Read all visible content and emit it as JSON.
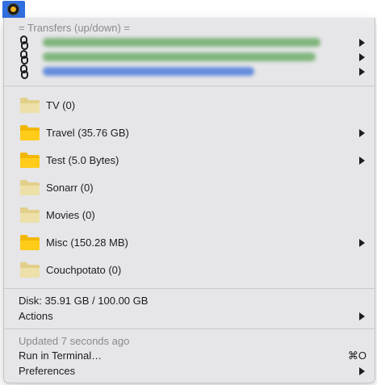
{
  "menu": {
    "transfers_header": "= Transfers (up/down) =",
    "transfers": [
      {
        "color": "#5fa55a"
      },
      {
        "color": "#5fa55a"
      },
      {
        "color": "#3b6fd8"
      }
    ],
    "folders": [
      {
        "label": "TV (0)",
        "state": "empty",
        "has_submenu": false
      },
      {
        "label": "Travel (35.76 GB)",
        "state": "full",
        "has_submenu": true
      },
      {
        "label": "Test (5.0 Bytes)",
        "state": "full",
        "has_submenu": true
      },
      {
        "label": "Sonarr (0)",
        "state": "empty",
        "has_submenu": false
      },
      {
        "label": "Movies (0)",
        "state": "empty",
        "has_submenu": false
      },
      {
        "label": "Misc (150.28 MB)",
        "state": "full",
        "has_submenu": true
      },
      {
        "label": "Couchpotato (0)",
        "state": "empty",
        "has_submenu": false
      }
    ],
    "disk": "Disk: 35.91 GB / 100.00 GB",
    "actions": "Actions",
    "updated": "Updated 7 seconds ago",
    "run_in_terminal": "Run in Terminal…",
    "run_in_terminal_shortcut": "⌘O",
    "preferences": "Preferences"
  },
  "colors": {
    "folder_full": "#ffcc1a",
    "folder_empty": "#e2cf89",
    "status_icon_bg": "#2f6fe0"
  }
}
